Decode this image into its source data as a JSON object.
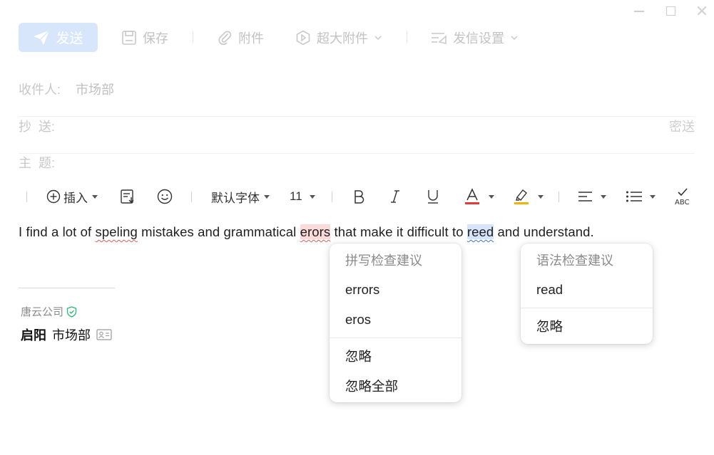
{
  "toolbar": {
    "send": "发送",
    "save": "保存",
    "attachment": "附件",
    "large_attachment": "超大附件",
    "send_settings": "发信设置"
  },
  "fields": {
    "to_label": "收件人:",
    "to_value": "市场部",
    "cc_label": "抄  送:",
    "bcc": "密送",
    "subject_label": "主  题:"
  },
  "format_toolbar": {
    "insert": "插入",
    "font": "默认字体",
    "size": "11",
    "colors": {
      "font_color": "#e53935",
      "highlight": "#f2b400"
    }
  },
  "body": {
    "seg1": "I find a lot of ",
    "misspelled1": "speling",
    "seg2": " mistakes and grammatical ",
    "misspelled2": "erors",
    "seg3": " that make it difficult to ",
    "grammar_word": "reed",
    "seg4": " and understand."
  },
  "signature": {
    "company": "唐云公司",
    "name": "启阳",
    "department": "市场部"
  },
  "spell_menu": {
    "title": "拼写检查建议",
    "suggestions": [
      "errors",
      "eros"
    ],
    "ignore": "忽略",
    "ignore_all": "忽略全部"
  },
  "grammar_menu": {
    "title": "语法检查建议",
    "suggestions": [
      "read"
    ],
    "ignore": "忽略"
  }
}
